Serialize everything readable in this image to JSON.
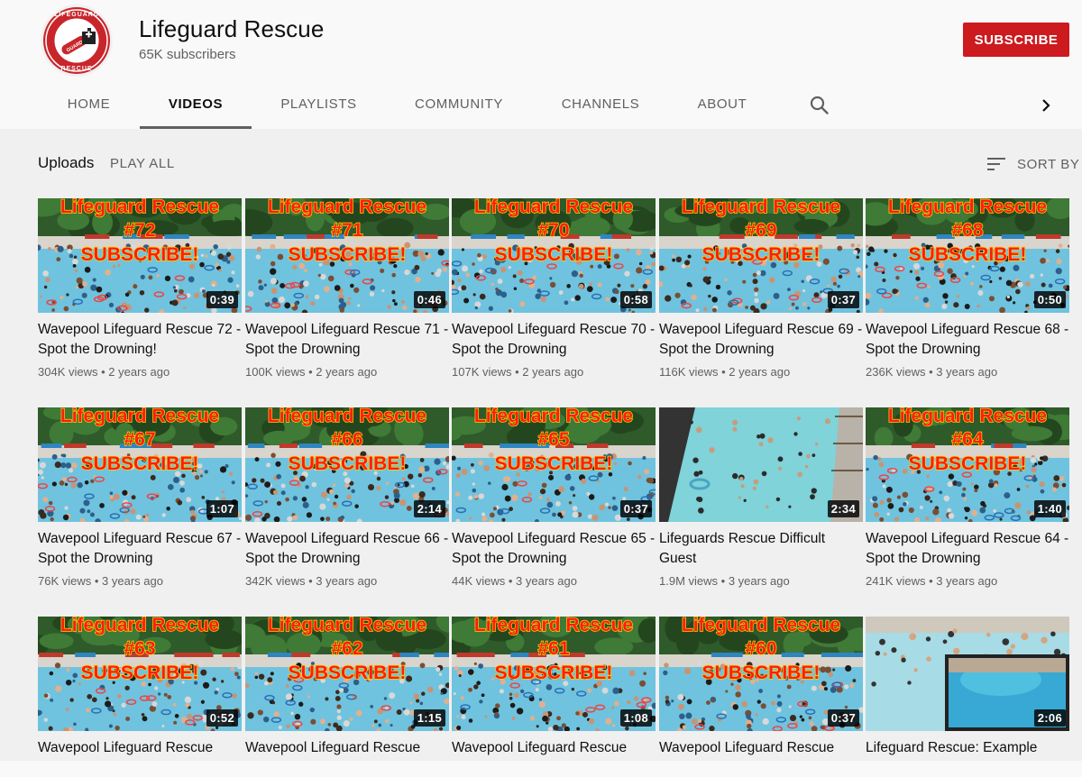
{
  "channel": {
    "name": "Lifeguard Rescue",
    "subscribers": "65K subscribers",
    "subscribe_label": "SUBSCRIBE",
    "logo_text_top": "LIFEGUARD",
    "logo_text_bottom": "RESCUE",
    "logo_icon": "lifeguard-logo"
  },
  "tabs": [
    {
      "label": "HOME",
      "active": false
    },
    {
      "label": "VIDEOS",
      "active": true
    },
    {
      "label": "PLAYLISTS",
      "active": false
    },
    {
      "label": "COMMUNITY",
      "active": false
    },
    {
      "label": "CHANNELS",
      "active": false
    },
    {
      "label": "ABOUT",
      "active": false
    }
  ],
  "icons": {
    "search": "search-icon",
    "next": "chevron-right-icon",
    "sort": "sort-icon"
  },
  "uploads": {
    "label": "Uploads",
    "play_all": "PLAY ALL",
    "sort_by": "SORT BY"
  },
  "colors": {
    "subscribe": "#cc1a1f",
    "thumb_text": "#ff1c10",
    "thumb_outline": "#ffd200"
  },
  "videos": [
    {
      "thumb_type": "branded",
      "thumb_title": "Lifeguard Rescue",
      "thumb_number": "#72",
      "thumb_sub": "SUBSCRIBE!",
      "duration": "0:39",
      "title": "Wavepool Lifeguard Rescue 72 - Spot the Drowning!",
      "views": "304K views",
      "age": "2 years ago"
    },
    {
      "thumb_type": "branded",
      "thumb_title": "Lifeguard Rescue",
      "thumb_number": "#71",
      "thumb_sub": "SUBSCRIBE!",
      "duration": "0:46",
      "title": "Wavepool Lifeguard Rescue 71 - Spot the Drowning",
      "views": "100K views",
      "age": "2 years ago"
    },
    {
      "thumb_type": "branded",
      "thumb_title": "Lifeguard Rescue",
      "thumb_number": "#70",
      "thumb_sub": "SUBSCRIBE!",
      "duration": "0:58",
      "title": "Wavepool Lifeguard Rescue 70 - Spot the Drowning",
      "views": "107K views",
      "age": "2 years ago"
    },
    {
      "thumb_type": "branded",
      "thumb_title": "Lifeguard Rescue",
      "thumb_number": "#69",
      "thumb_sub": "SUBSCRIBE!",
      "duration": "0:37",
      "title": "Wavepool Lifeguard Rescue 69 - Spot the Drowning",
      "views": "116K views",
      "age": "2 years ago"
    },
    {
      "thumb_type": "branded",
      "thumb_title": "Lifeguard Rescue",
      "thumb_number": "#68",
      "thumb_sub": "SUBSCRIBE!",
      "duration": "0:50",
      "title": "Wavepool Lifeguard Rescue 68 - Spot the Drowning",
      "views": "236K views",
      "age": "3 years ago"
    },
    {
      "thumb_type": "branded",
      "thumb_title": "Lifeguard Rescue",
      "thumb_number": "#67",
      "thumb_sub": "SUBSCRIBE!",
      "duration": "1:07",
      "title": "Wavepool Lifeguard Rescue 67 - Spot the Drowning",
      "views": "76K views",
      "age": "3 years ago"
    },
    {
      "thumb_type": "branded",
      "thumb_title": "Lifeguard Rescue",
      "thumb_number": "#66",
      "thumb_sub": "SUBSCRIBE!",
      "duration": "2:14",
      "title": "Wavepool Lifeguard Rescue 66 - Spot the Drowning",
      "views": "342K views",
      "age": "3 years ago"
    },
    {
      "thumb_type": "branded",
      "thumb_title": "Lifeguard Rescue",
      "thumb_number": "#65",
      "thumb_sub": "SUBSCRIBE!",
      "duration": "0:37",
      "title": "Wavepool Lifeguard Rescue 65 - Spot the Drowning",
      "views": "44K views",
      "age": "3 years ago"
    },
    {
      "thumb_type": "pool",
      "thumb_title": "",
      "thumb_number": "",
      "thumb_sub": "",
      "duration": "2:34",
      "title": "Lifeguards Rescue Difficult Guest",
      "views": "1.9M views",
      "age": "3 years ago"
    },
    {
      "thumb_type": "branded",
      "thumb_title": "Lifeguard Rescue",
      "thumb_number": "#64",
      "thumb_sub": "SUBSCRIBE!",
      "duration": "1:40",
      "title": "Wavepool Lifeguard Rescue 64 - Spot the Drowning",
      "views": "241K views",
      "age": "3 years ago"
    },
    {
      "thumb_type": "branded",
      "thumb_title": "Lifeguard Rescue",
      "thumb_number": "#63",
      "thumb_sub": "SUBSCRIBE!",
      "duration": "0:52",
      "title": "Wavepool Lifeguard Rescue",
      "views": "",
      "age": ""
    },
    {
      "thumb_type": "branded",
      "thumb_title": "Lifeguard Rescue",
      "thumb_number": "#62",
      "thumb_sub": "SUBSCRIBE!",
      "duration": "1:15",
      "title": "Wavepool Lifeguard Rescue",
      "views": "",
      "age": ""
    },
    {
      "thumb_type": "branded",
      "thumb_title": "Lifeguard Rescue",
      "thumb_number": "#61",
      "thumb_sub": "SUBSCRIBE!",
      "duration": "1:08",
      "title": "Wavepool Lifeguard Rescue",
      "views": "",
      "age": ""
    },
    {
      "thumb_type": "branded",
      "thumb_title": "Lifeguard Rescue",
      "thumb_number": "#60",
      "thumb_sub": "SUBSCRIBE!",
      "duration": "0:37",
      "title": "Wavepool Lifeguard Rescue",
      "views": "",
      "age": ""
    },
    {
      "thumb_type": "pool2",
      "thumb_title": "",
      "thumb_number": "",
      "thumb_sub": "",
      "duration": "2:06",
      "title": "Lifeguard Rescue: Example",
      "views": "",
      "age": ""
    }
  ]
}
